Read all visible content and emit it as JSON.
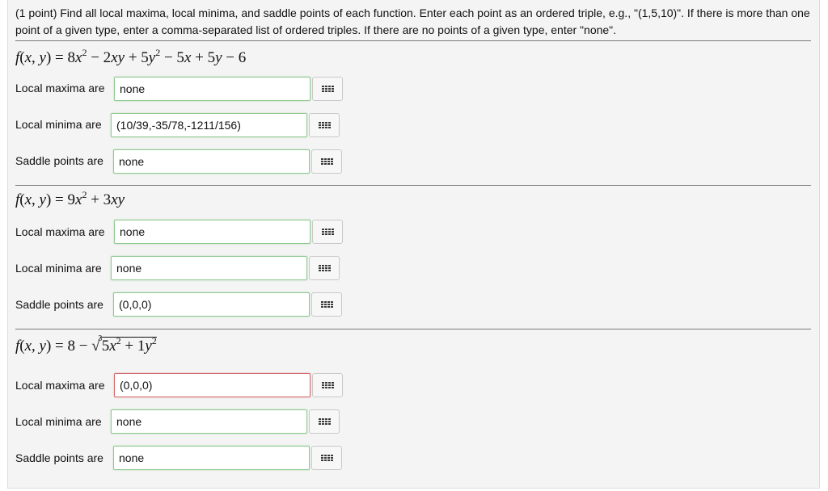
{
  "problem": {
    "intro": "(1 point) Find all local maxima, local minima, and saddle points of each function. Enter each point as an ordered triple, e.g., \"(1,5,10)\". If there is more than one point of a given type, enter a comma-separated list of ordered triples. If there are no points of a given type, enter \"none\"."
  },
  "parts": [
    {
      "function_text": "f(x, y) = 8x² − 2xy + 5y² − 5x + 5y − 6",
      "maxima_label": "Local maxima are",
      "maxima_value": "none",
      "minima_label": "Local minima are",
      "minima_value": "(10/39,-35/78,-1211/156)",
      "saddle_label": "Saddle points are",
      "saddle_value": "none"
    },
    {
      "function_text": "f(x, y) = 9x² + 3xy",
      "maxima_label": "Local maxima are",
      "maxima_value": "none",
      "minima_label": "Local minima are",
      "minima_value": "none",
      "saddle_label": "Saddle points are",
      "saddle_value": "(0,0,0)"
    },
    {
      "function_text": "f(x, y) = 8 − ∛(5x² + 1y²)",
      "maxima_label": "Local maxima are",
      "maxima_value": "(0,0,0)",
      "minima_label": "Local minima are",
      "minima_value": "none",
      "saddle_label": "Saddle points are",
      "saddle_value": "none"
    }
  ],
  "colors": {
    "correct_border": "#8fc98f",
    "incorrect_border": "#d26a6a"
  },
  "icons": {
    "equation_editor": "grid-icon"
  }
}
